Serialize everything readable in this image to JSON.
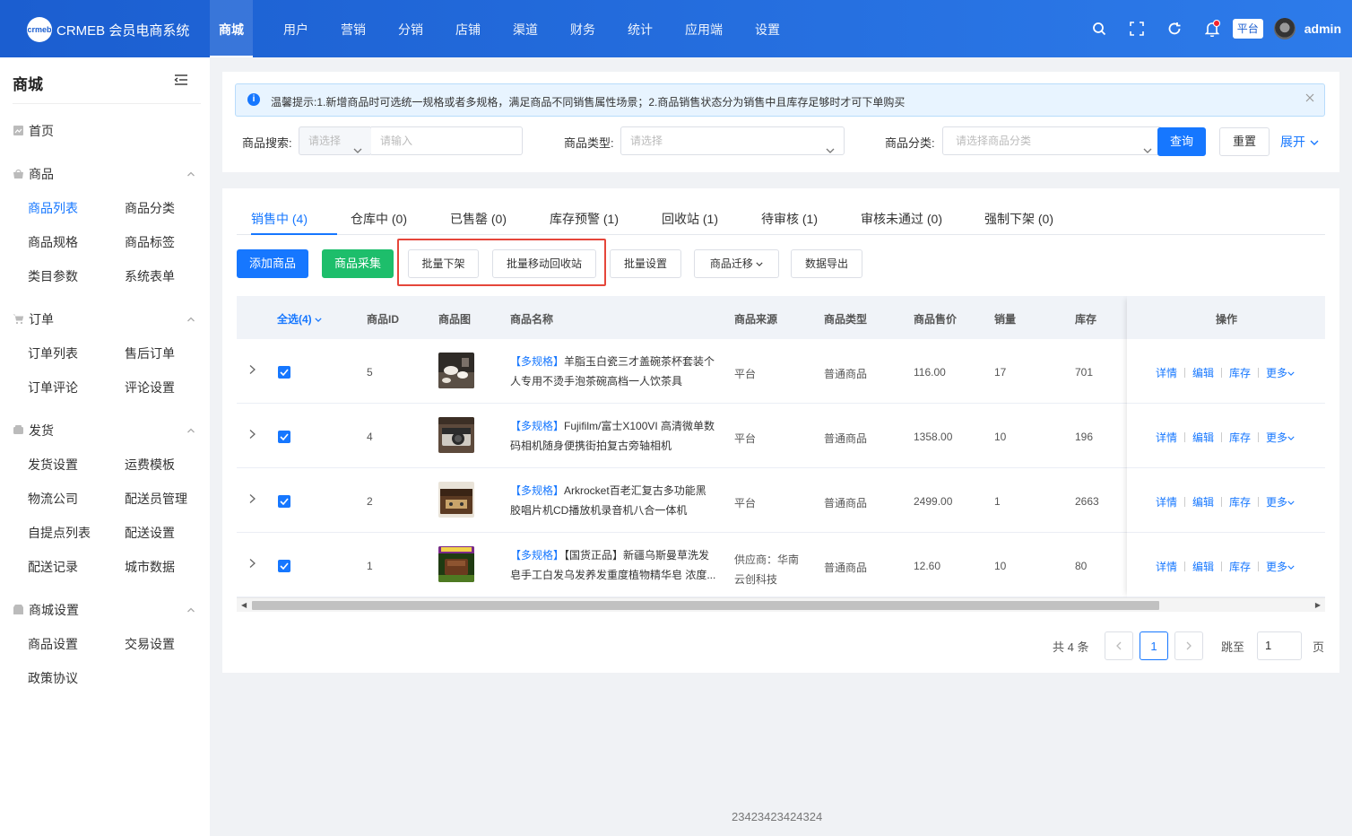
{
  "header": {
    "logo_mark": "crmeb",
    "logo_text": "CRMEB 会员电商系统",
    "nav": [
      {
        "label": "商城",
        "active": true
      },
      {
        "label": "用户"
      },
      {
        "label": "营销"
      },
      {
        "label": "分销"
      },
      {
        "label": "店铺"
      },
      {
        "label": "渠道"
      },
      {
        "label": "财务"
      },
      {
        "label": "统计"
      },
      {
        "label": "应用端"
      },
      {
        "label": "设置"
      }
    ],
    "platform_tag": "平台",
    "admin_name": "admin",
    "icons": [
      "search-icon",
      "fullscreen-icon",
      "refresh-icon",
      "bell-icon"
    ]
  },
  "sidebar": {
    "title": "商城",
    "home": "首页",
    "groups": [
      {
        "label": "商品",
        "icon": "bag-icon",
        "items": [
          "商品列表",
          "商品分类",
          "商品规格",
          "商品标签",
          "类目参数",
          "系统表单"
        ]
      },
      {
        "label": "订单",
        "icon": "cart-icon",
        "items": [
          "订单列表",
          "售后订单",
          "订单评论",
          "评论设置"
        ]
      },
      {
        "label": "发货",
        "icon": "truck-icon",
        "items": [
          "发货设置",
          "运费模板",
          "物流公司",
          "配送员管理",
          "自提点列表",
          "配送设置",
          "配送记录",
          "城市数据"
        ]
      },
      {
        "label": "商城设置",
        "icon": "store-icon",
        "items": [
          "商品设置",
          "交易设置",
          "政策协议"
        ]
      }
    ]
  },
  "alert": {
    "text": "温馨提示:1.新增商品时可选统一规格或者多规格，满足商品不同销售属性场景；2.商品销售状态分为销售中且库存足够时才可下单购买"
  },
  "filters": {
    "search_label": "商品搜索:",
    "search_select_placeholder": "请选择",
    "search_input_placeholder": "请输入",
    "type_label": "商品类型:",
    "type_placeholder": "请选择",
    "category_label": "商品分类:",
    "category_placeholder": "请选择商品分类",
    "query_button": "查询",
    "reset_button": "重置",
    "expand_link": "展开"
  },
  "tabs": [
    {
      "label": "销售中 (4)",
      "active": true
    },
    {
      "label": "仓库中 (0)"
    },
    {
      "label": "已售罄 (0)"
    },
    {
      "label": "库存预警 (1)"
    },
    {
      "label": "回收站 (1)"
    },
    {
      "label": "待审核 (1)"
    },
    {
      "label": "审核未通过 (0)"
    },
    {
      "label": "强制下架 (0)"
    }
  ],
  "toolbar": {
    "add": "添加商品",
    "collect": "商品采集",
    "batch_off": "批量下架",
    "batch_recycle": "批量移动回收站",
    "batch_settings": "批量设置",
    "migrate": "商品迁移",
    "export": "数据导出"
  },
  "table": {
    "headers": {
      "select_all": "全选(4)",
      "id": "商品ID",
      "image": "商品图",
      "name": "商品名称",
      "source": "商品来源",
      "type": "商品类型",
      "price": "商品售价",
      "sales": "销量",
      "stock": "库存",
      "actions": "操作"
    },
    "rows": [
      {
        "id": "5",
        "tag": "【多规格】",
        "name_line1": "羊脂玉白瓷三才盖碗茶杯套装个",
        "name_line2": "人专用不烫手泡茶碗高档一人饮茶具",
        "source1": "平台",
        "source2": "",
        "type": "普通商品",
        "price": "116.00",
        "sales": "17",
        "stock": "701",
        "thumb": "tea"
      },
      {
        "id": "4",
        "tag": "【多规格】",
        "name_line1": "Fujifilm/富士X100VI 高清微单数",
        "name_line2": "码相机随身便携街拍复古旁轴相机",
        "source1": "平台",
        "source2": "",
        "type": "普通商品",
        "price": "1358.00",
        "sales": "10",
        "stock": "196",
        "thumb": "camera"
      },
      {
        "id": "2",
        "tag": "【多规格】",
        "name_line1": "Arkrocket百老汇复古多功能黑",
        "name_line2": "胶唱片机CD播放机录音机八合一体机",
        "source1": "平台",
        "source2": "",
        "type": "普通商品",
        "price": "2499.00",
        "sales": "1",
        "stock": "2663",
        "thumb": "record"
      },
      {
        "id": "1",
        "tag": "【多规格】",
        "name_line1": "【国货正品】新疆乌斯曼草洗发",
        "name_line2": "皂手工白发乌发养发重度植物精华皂 浓度...",
        "source1": "供应商：华南",
        "source2": "云创科技",
        "type": "普通商品",
        "price": "12.60",
        "sales": "10",
        "stock": "80",
        "thumb": "soap"
      }
    ],
    "actions": [
      "详情",
      "编辑",
      "库存",
      "更多"
    ]
  },
  "pagination": {
    "total": "共 4 条",
    "current": "1",
    "jump_label": "跳至",
    "jump_value": "1",
    "page_suffix": "页"
  },
  "footer": "23423423424324",
  "colors": {
    "primary": "#1677ff",
    "success": "#1dbe6b",
    "highlight": "#e5463a"
  }
}
